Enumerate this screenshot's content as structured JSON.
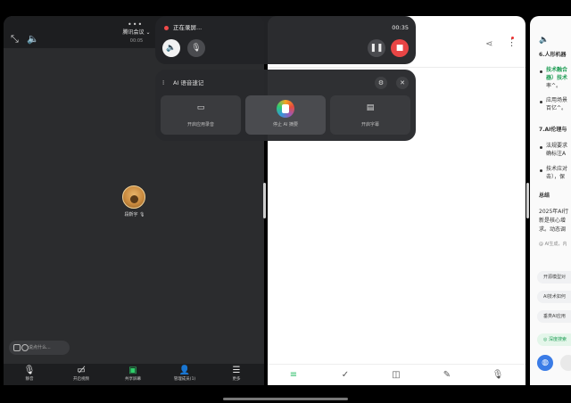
{
  "meeting": {
    "title": "腾讯会议",
    "time": "00:05",
    "participant": "段靳宇",
    "chat_placeholder": "说点什么...",
    "toolbar": [
      {
        "label": "静音",
        "icon": "mic-icon"
      },
      {
        "label": "开启视频",
        "icon": "video-icon"
      },
      {
        "label": "共享屏幕",
        "icon": "screen-share-icon"
      },
      {
        "label": "管理成员(1)",
        "icon": "members-icon"
      },
      {
        "label": "更多",
        "icon": "more-icon"
      }
    ]
  },
  "recording": {
    "label": "正在录屏...",
    "time": "00:35"
  },
  "ai_panel": {
    "title": "AI 语音速记",
    "cards": [
      {
        "label": "开启应用录音"
      },
      {
        "label": "停止 AI 摘要"
      },
      {
        "label": "开启字幕"
      }
    ]
  },
  "right_panel": {
    "lines": [
      {
        "text": "6.人形机器",
        "style": "bold"
      },
      {
        "text": "技术融合",
        "style": "green"
      },
      {
        "text": "器）技术",
        "style": "green"
      },
      {
        "text": "率^。",
        "style": "normal"
      },
      {
        "text": "应用场景",
        "style": "normal"
      },
      {
        "text": "百亿^。",
        "style": "normal"
      },
      {
        "text": "7.AI伦理与",
        "style": "bold"
      },
      {
        "text": "法规要求",
        "style": "normal"
      },
      {
        "text": "确标注A",
        "style": "normal"
      },
      {
        "text": "技术应对",
        "style": "normal"
      },
      {
        "text": "击），保",
        "style": "normal"
      },
      {
        "text": "总结",
        "style": "bold"
      },
      {
        "text": "2025年AI行",
        "style": "normal"
      },
      {
        "text": "新是核心增",
        "style": "normal"
      },
      {
        "text": "求。动态调",
        "style": "normal"
      },
      {
        "text": "@ AI生成，内",
        "style": "gray"
      }
    ],
    "chips": [
      "开源模型对",
      "AI技术如何",
      "垂类AI应用"
    ],
    "deep_chip": "◎ 深度搜索"
  }
}
